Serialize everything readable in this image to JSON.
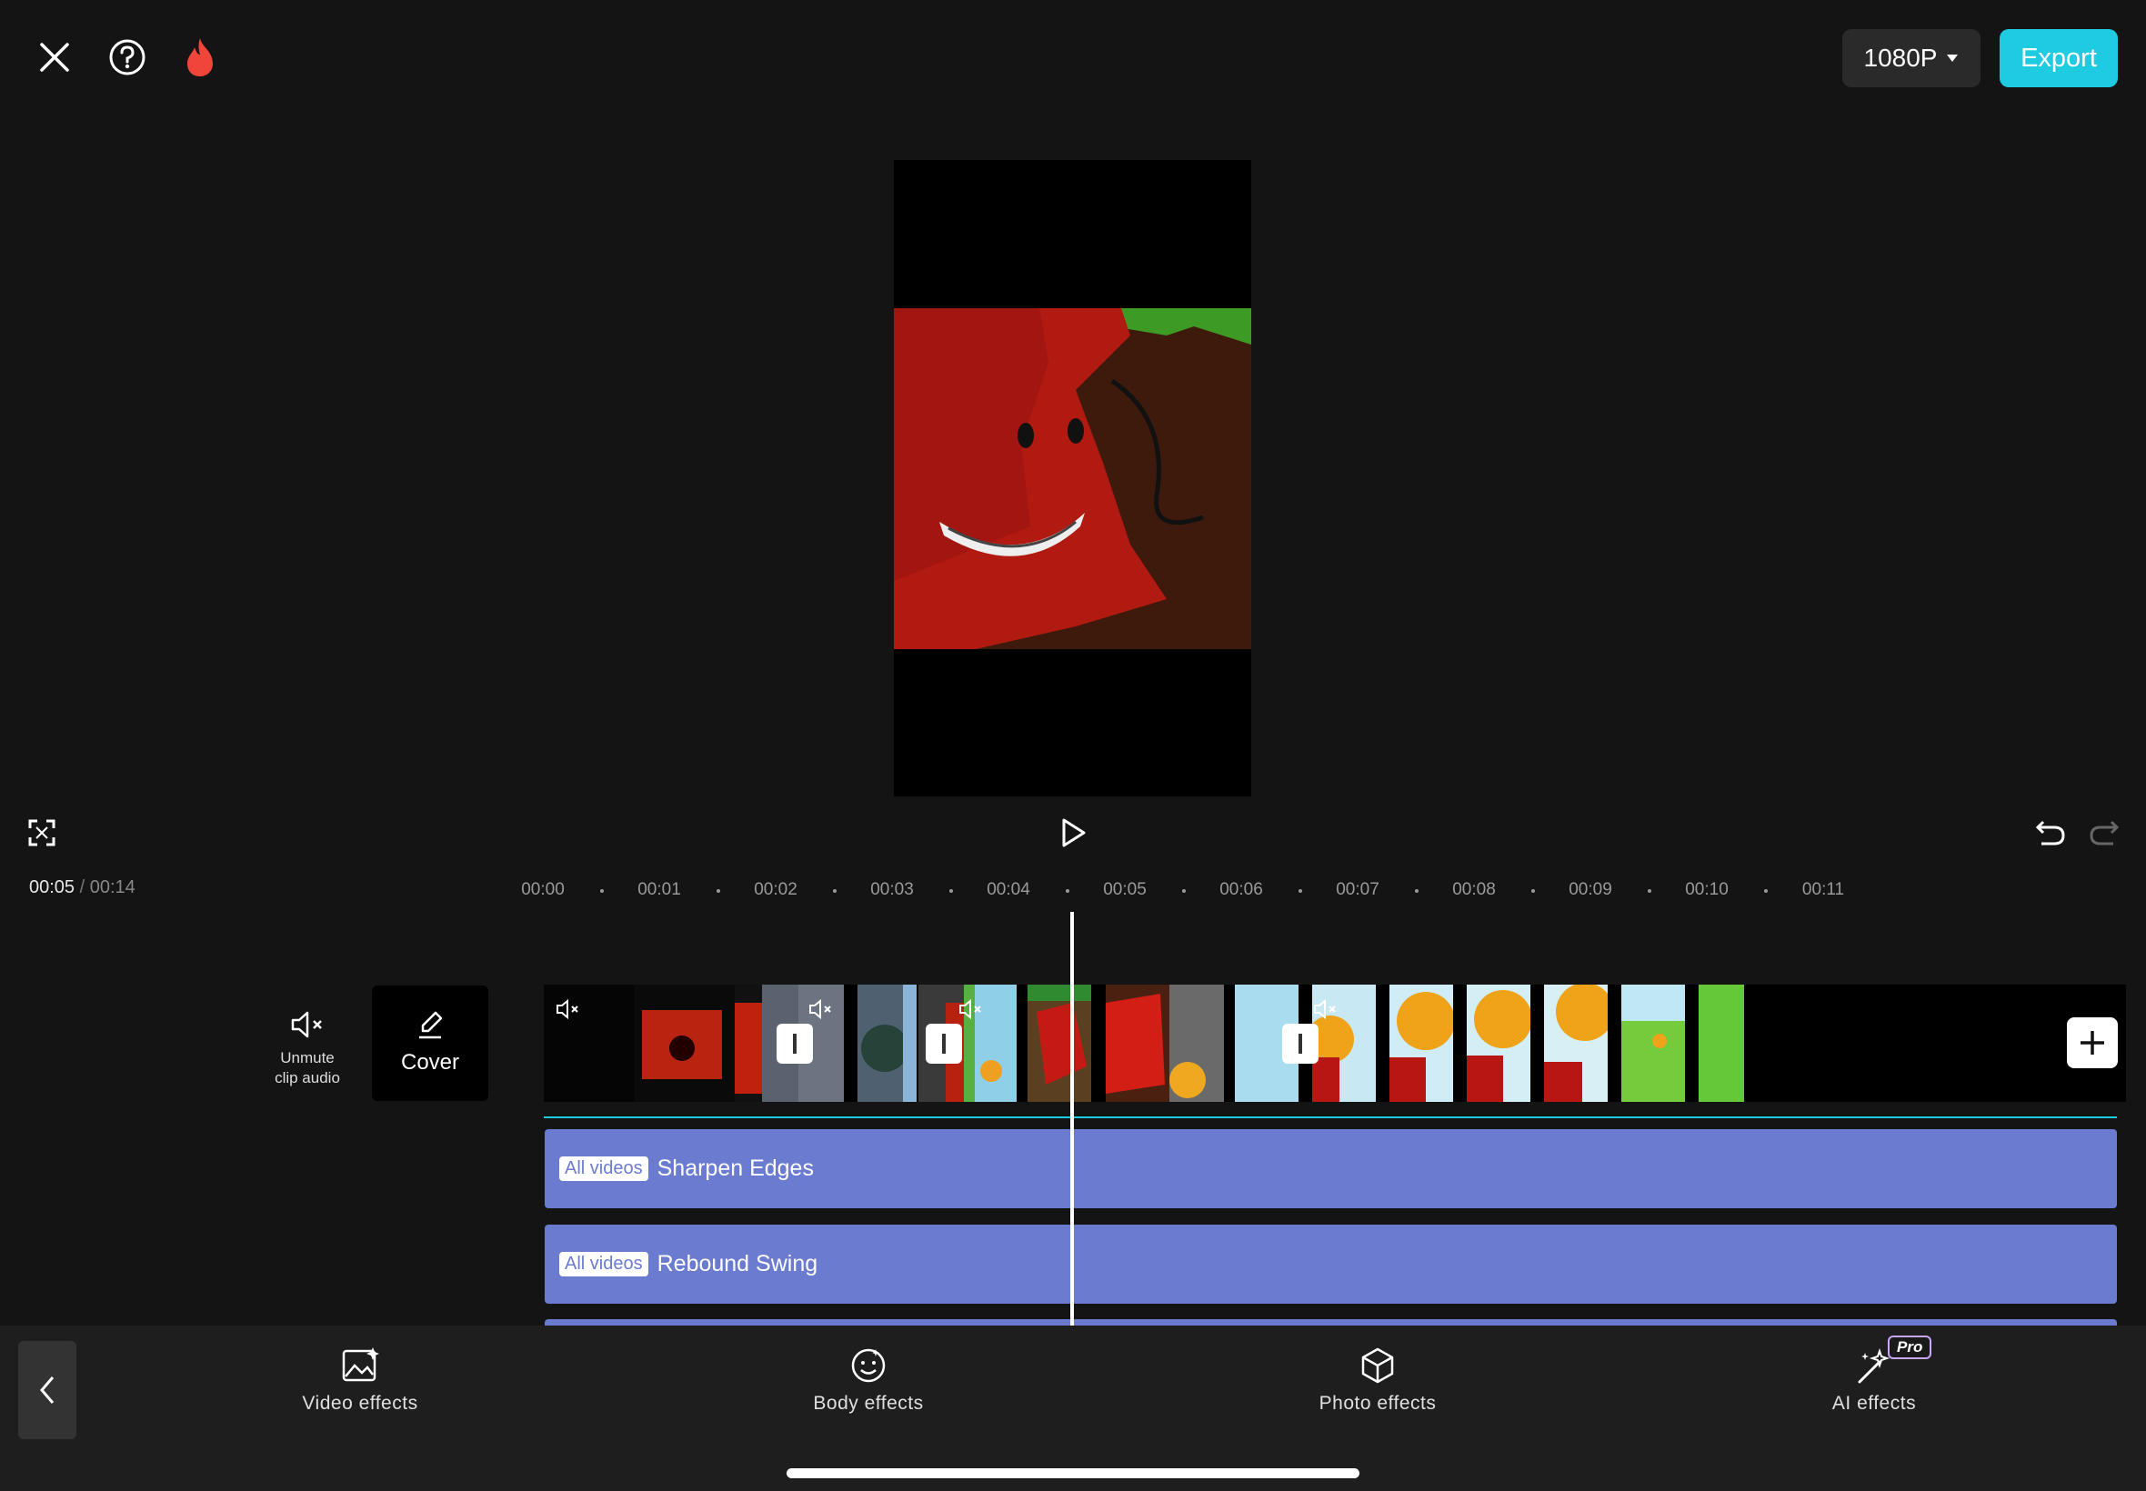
{
  "header": {
    "resolution": "1080P",
    "export_label": "Export"
  },
  "player": {
    "current_time": "00:05",
    "separator": "/",
    "total_time": "00:14"
  },
  "ruler": {
    "labels": [
      "00:00",
      "00:01",
      "00:02",
      "00:03",
      "00:04",
      "00:05",
      "00:06",
      "00:07",
      "00:08",
      "00:09",
      "00:10",
      "00:11"
    ]
  },
  "left_controls": {
    "unmute_label_line1": "Unmute",
    "unmute_label_line2": "clip audio",
    "cover_label": "Cover"
  },
  "effect_tracks": [
    {
      "tag": "All videos",
      "name": "Sharpen Edges"
    },
    {
      "tag": "All videos",
      "name": "Rebound Swing"
    }
  ],
  "toolbar": {
    "items": [
      {
        "label": "Video effects",
        "icon": "video-effects-icon"
      },
      {
        "label": "Body effects",
        "icon": "body-effects-icon"
      },
      {
        "label": "Photo effects",
        "icon": "photo-effects-icon"
      },
      {
        "label": "AI effects",
        "icon": "ai-effects-icon",
        "badge": "Pro"
      }
    ]
  },
  "colors": {
    "accent": "#1ecbe1",
    "effect_track": "#6b7bd0",
    "background": "#141414"
  }
}
